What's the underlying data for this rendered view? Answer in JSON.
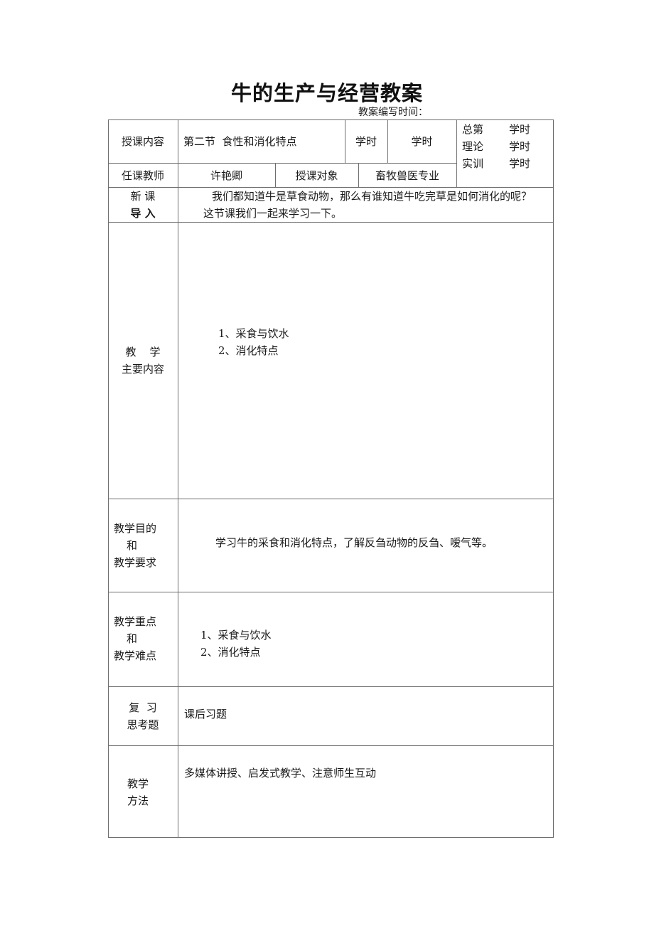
{
  "document": {
    "title": "牛的生产与经营教案",
    "subtitle": "教案编写时间："
  },
  "header_rows": {
    "row1": {
      "label": "授课内容",
      "content": "第二节  食性和消化特点",
      "hours_label_1": "学时",
      "hours_label_2": "学时"
    },
    "hours_breakdown": [
      {
        "name": "总第",
        "unit": "学时"
      },
      {
        "name": "理论",
        "unit": "学时"
      },
      {
        "name": "实训",
        "unit": "学时"
      }
    ],
    "row2": {
      "teacher_label": "任课教师",
      "teacher_name": "许艳卿",
      "audience_label": "授课对象",
      "audience_value": "畜牧兽医专业"
    }
  },
  "sections": {
    "intro": {
      "label_line1": "新 课",
      "label_line2": "导 入",
      "text_line1": "我们都知道牛是草食动物，那么有谁知道牛吃完草是如何消化的呢？",
      "text_line2": "这节课我们一起来学习一下。"
    },
    "main_content": {
      "label_line1": "教    学",
      "label_line2": "主要内容",
      "items": [
        "1、采食与饮水",
        "2、消化特点"
      ]
    },
    "objectives": {
      "label_line1": "教学目的",
      "label_line2": "和",
      "label_line3": "教学要求",
      "text": "学习牛的采食和消化特点，了解反刍动物的反刍、嗳气等。"
    },
    "key_points": {
      "label_line1": "教学重点",
      "label_line2": "和",
      "label_line3": "教学难点",
      "items": [
        "1、采食与饮水",
        "2、消化特点"
      ]
    },
    "review": {
      "label_line1": "复  习",
      "label_line2": "思考题",
      "text": "课后习题"
    },
    "method": {
      "label_line1": "教学",
      "label_line2": "方法",
      "text": "多媒体讲授、启发式教学、注意师生互动"
    }
  }
}
